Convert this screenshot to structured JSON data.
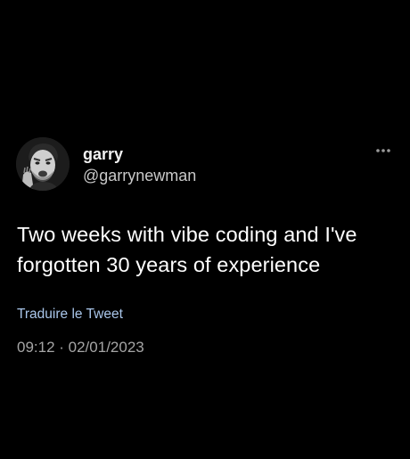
{
  "tweet": {
    "author": {
      "display_name": "garry",
      "handle": "@garrynewman",
      "avatar_icon": "profile-photo"
    },
    "more_icon": "more-horizontal-icon",
    "text": "Two weeks with vibe coding and I've forgotten 30 years of experience",
    "translate_label": "Traduire le Tweet",
    "timestamp": "09:12 · 02/01/2023"
  },
  "colors": {
    "background": "#000000",
    "text_primary": "#ffffff",
    "text_secondary": "#a5a5a5",
    "link": "#a9c6ea"
  }
}
